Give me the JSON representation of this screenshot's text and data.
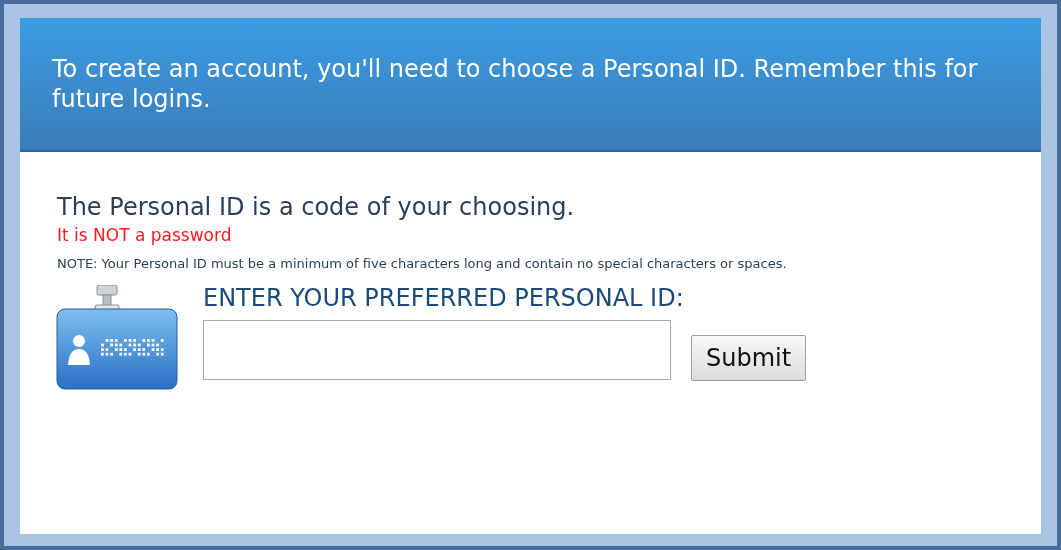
{
  "header": {
    "text": "To create an account, you'll need to choose a Personal ID. Remember this for future logins."
  },
  "intro": "The Personal ID is a code of your choosing.",
  "warning": "It is NOT a password",
  "note": "NOTE: Your Personal ID must be a minimum of five characters long and contain no special characters or spaces.",
  "form": {
    "label": "ENTER YOUR PREFERRED PERSONAL ID:",
    "button": "Submit"
  }
}
